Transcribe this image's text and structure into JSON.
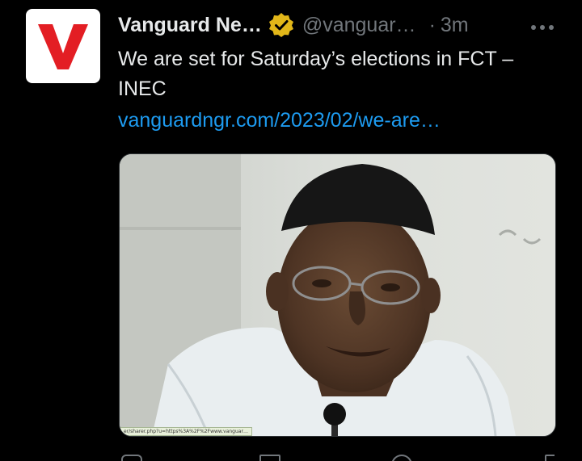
{
  "tweet": {
    "author_name": "Vanguard Ne…",
    "handle": "@vanguar…",
    "separator": "·",
    "time": "3m",
    "text": "We are set for Saturday’s elections in FCT – INEC",
    "link": "vanguardngr.com/2023/02/we-are…",
    "avatar_letter": "V",
    "media_status_url": "er/sharer.php?u=https%3A%2F%2Fwww.vanguar…"
  },
  "icons": {
    "verified": "verified-badge-icon",
    "more": "more-options-icon",
    "reply": "reply-icon",
    "retweet": "retweet-icon",
    "like": "like-icon",
    "share": "share-icon"
  },
  "colors": {
    "background": "#000000",
    "text": "#e7e9ea",
    "secondary": "#71767b",
    "link": "#1d9bf0",
    "brand_red": "#e31e24",
    "verified_gold": "#e2b719"
  }
}
